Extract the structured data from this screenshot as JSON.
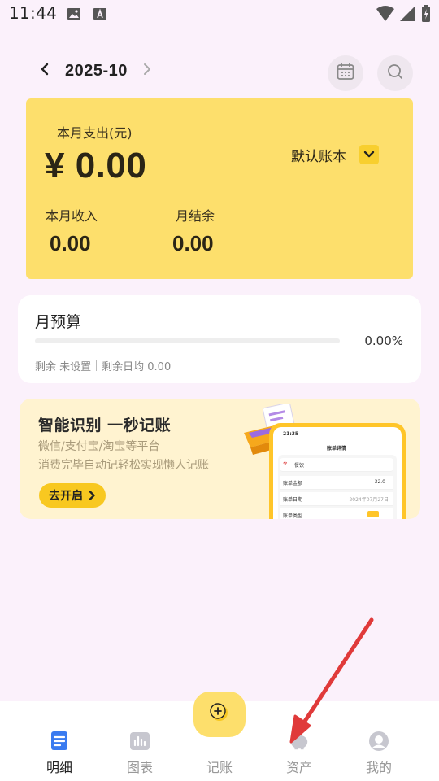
{
  "status_bar": {
    "time": "11:44"
  },
  "header": {
    "month": "2025-10"
  },
  "summary": {
    "expense_label": "本月支出(元)",
    "expense_amount": "¥ 0.00",
    "ledger_name": "默认账本",
    "income_label": "本月收入",
    "income_amount": "0.00",
    "balance_label": "月结余",
    "balance_amount": "0.00",
    "card_color": "#fddf6c"
  },
  "budget": {
    "title": "月预算",
    "percent": "0.00%",
    "progress_fraction": 0,
    "remaining": "剩余 未设置",
    "daily_remaining": "剩余日均 0.00"
  },
  "promo": {
    "title": "智能识别 一秒记账",
    "line1": "微信/支付宝/淘宝等平台",
    "line2": "消费完毕自动记轻松实现懒人记账",
    "button_label": "去开启",
    "phone": {
      "time": "21:35",
      "screen_title": "账单详情",
      "category": "餐饮",
      "amount_label": "账单金额",
      "amount_value": "-32.0",
      "date_label": "账单日期",
      "date_value": "2024年07月27日",
      "type_label": "账单类型"
    }
  },
  "bottom_nav": {
    "items": [
      {
        "label": "明细",
        "icon": "list-doc-icon",
        "active": true
      },
      {
        "label": "图表",
        "icon": "chart-icon",
        "active": false
      },
      {
        "label": "记账",
        "icon": "add-icon",
        "active": false
      },
      {
        "label": "资产",
        "icon": "piggy-bank-icon",
        "active": false
      },
      {
        "label": "我的",
        "icon": "profile-icon",
        "active": false
      }
    ]
  },
  "colors": {
    "accent": "#f8cf2f",
    "background": "#fbf1fb",
    "annotation_arrow": "#e03a3a"
  }
}
